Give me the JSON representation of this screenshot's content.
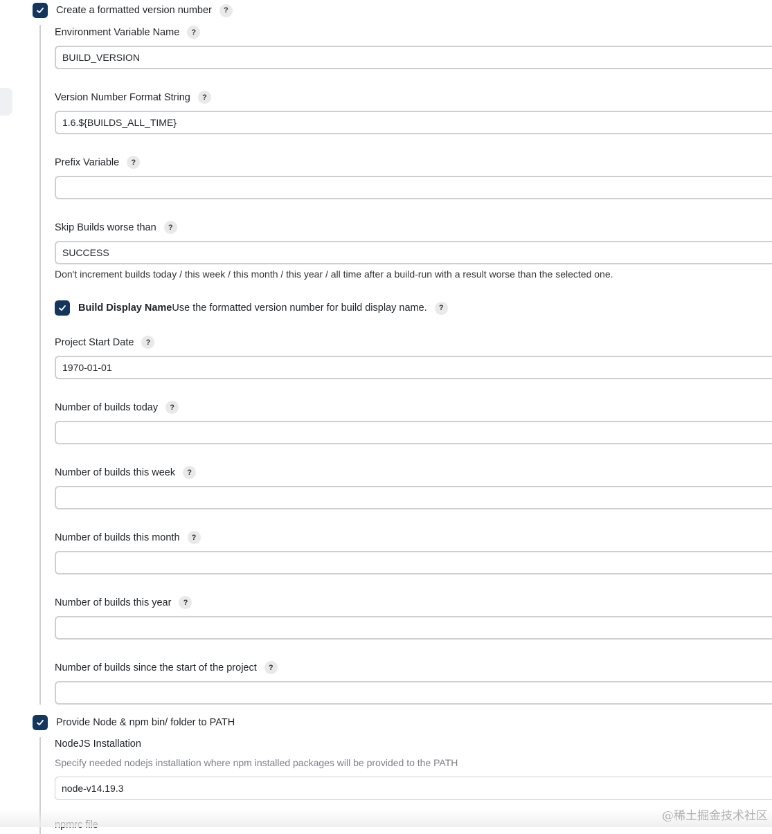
{
  "version_section": {
    "checkbox_label": "Create a formatted version number",
    "checked": true,
    "help": "?",
    "fields": [
      {
        "label": "Environment Variable Name",
        "value": "BUILD_VERSION"
      },
      {
        "label": "Version Number Format String",
        "value": "1.6.${BUILDS_ALL_TIME}"
      },
      {
        "label": "Prefix Variable",
        "value": ""
      },
      {
        "label": "Skip Builds worse than",
        "value": "SUCCESS"
      }
    ],
    "skip_description": "Don't increment builds today / this week / this month / this year / all time after a build-run with a result worse than the selected one.",
    "display_name": {
      "checked": true,
      "bold_label": "Build Display Name",
      "label": "Use the formatted version number for build display name."
    },
    "fields2": [
      {
        "label": "Project Start Date",
        "value": "1970-01-01"
      },
      {
        "label": "Number of builds today",
        "value": ""
      },
      {
        "label": "Number of builds this week",
        "value": ""
      },
      {
        "label": "Number of builds this month",
        "value": ""
      },
      {
        "label": "Number of builds this year",
        "value": ""
      },
      {
        "label": "Number of builds since the start of the project",
        "value": ""
      }
    ]
  },
  "node_section": {
    "checkbox_label": "Provide Node & npm bin/ folder to PATH",
    "checked": true,
    "installation_label": "NodeJS Installation",
    "installation_description": "Specify needed nodejs installation where npm installed packages will be provided to the PATH",
    "installation_value": "node-v14.19.3",
    "npmrc_label": "npmrc file"
  },
  "watermark": "@稀土掘金技术社区"
}
